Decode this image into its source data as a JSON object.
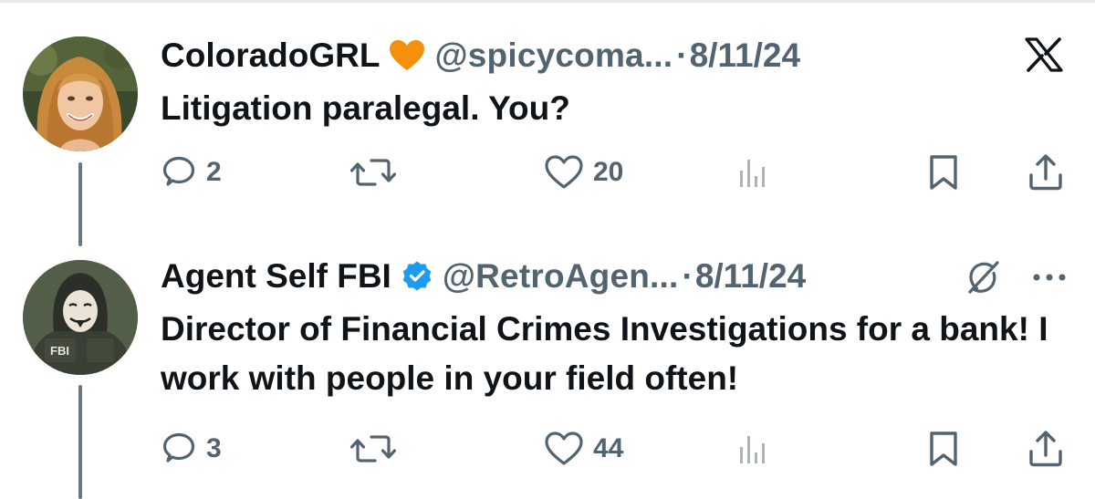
{
  "tweets": [
    {
      "author": {
        "name": "ColoradoGRL",
        "emoji": "🧡",
        "handle": "@spicycoma...",
        "avatar": "woman-portrait-avatar"
      },
      "separator": "·",
      "date": "8/11/24",
      "text": "Litigation paralegal. You?",
      "replies": "2",
      "retweets": "",
      "likes": "20",
      "corner_icon": "x-logo-icon"
    },
    {
      "author": {
        "name": "Agent Self FBI",
        "verified": true,
        "handle": "@RetroAgen...",
        "avatar": "masked-agent-avatar",
        "avatar_label": "FBI"
      },
      "separator": "·",
      "date": "8/11/24",
      "text": "Director of Financial Crimes Investigations for a bank! I work with people in your field often!",
      "replies": "3",
      "retweets": "",
      "likes": "44",
      "corner_icons": [
        "grok-icon",
        "more-options-icon"
      ]
    }
  ],
  "colors": {
    "text": "#0f1419",
    "muted": "#536471",
    "verified": "#1d9bf0",
    "thread_line": "#6b7680"
  }
}
